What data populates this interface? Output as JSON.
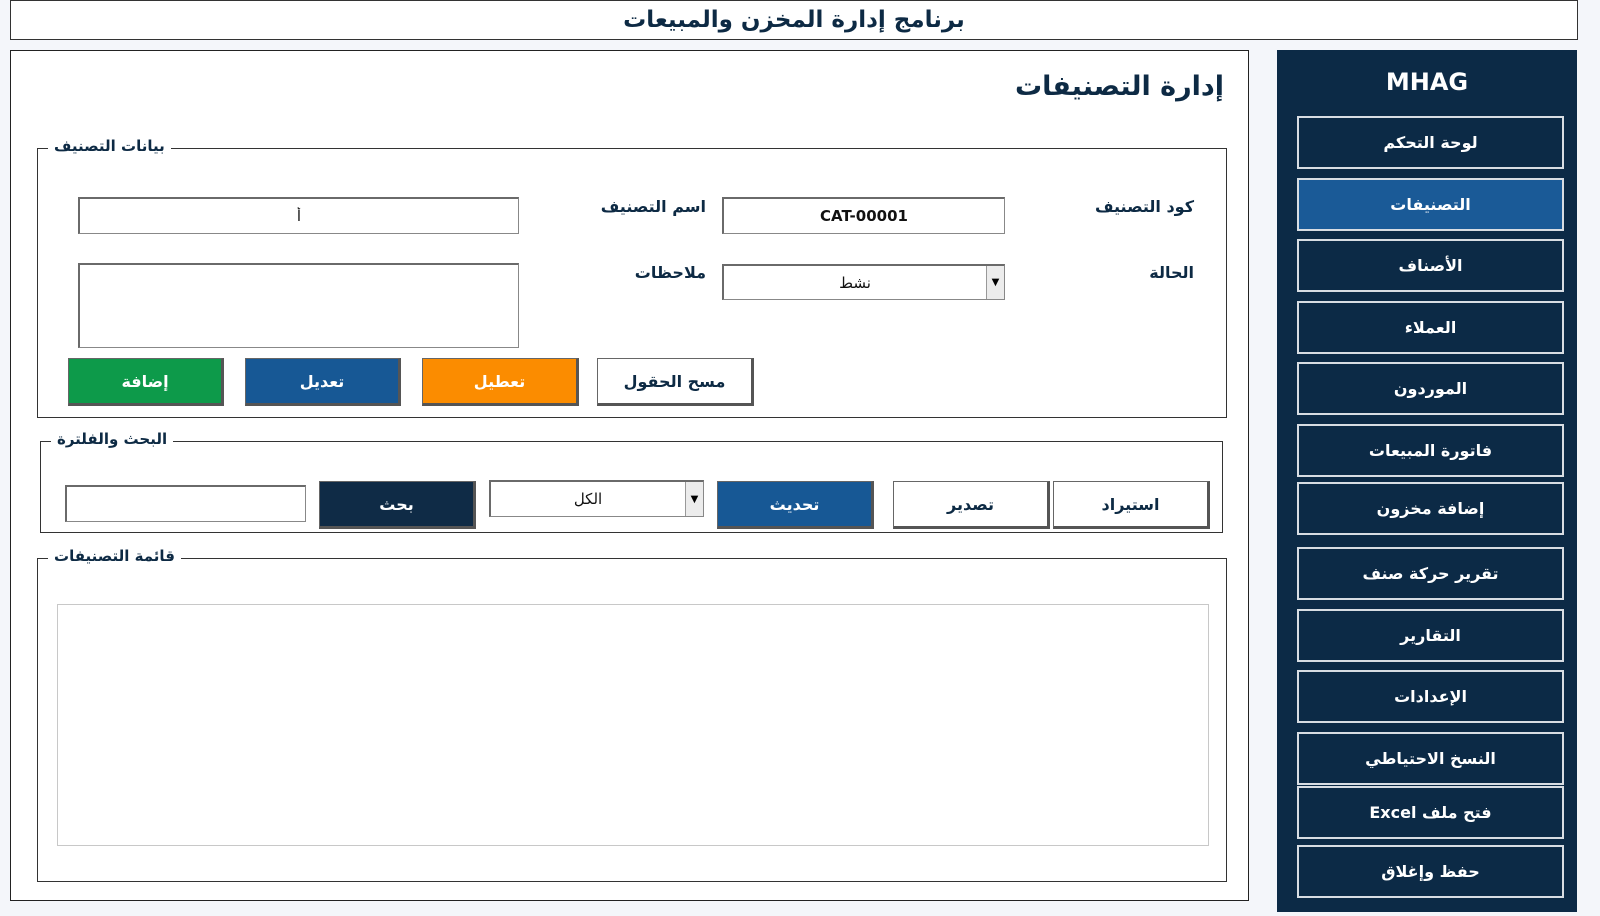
{
  "app_title": "برنامج إدارة المخزن والمبيعات",
  "page": {
    "heading": "إدارة التصنيفات",
    "category_section": {
      "legend": "بيانات التصنيف",
      "code_label": "كود التصنيف",
      "code_value": "CAT-00001",
      "name_label": "اسم التصنيف",
      "name_value": "أ",
      "status_label": "الحالة",
      "status_value": "نشط",
      "notes_label": "ملاحظات",
      "notes_value": "",
      "buttons": {
        "add": "إضافة",
        "edit": "تعديل",
        "disable": "تعطيل",
        "clear": "مسح الحقول"
      },
      "colors": {
        "add": "#0d9a4a",
        "edit": "#175895",
        "disable": "#fb8c00"
      }
    },
    "search_section": {
      "legend": "البحث والفلترة",
      "search_value": "",
      "search_button": "بحث",
      "filter_value": "الكل",
      "refresh_button": "تحديث",
      "export_button": "تصدير",
      "import_button": "استيراد"
    },
    "list_section": {
      "legend": "قائمة التصنيفات"
    }
  },
  "sidebar": {
    "brand": "MHAG",
    "accent": "#1a5a97",
    "background": "#0c2a46",
    "items": [
      {
        "label": "لوحة التحكم",
        "active": false
      },
      {
        "label": "التصنيفات",
        "active": true
      },
      {
        "label": "الأصناف",
        "active": false
      },
      {
        "label": "العملاء",
        "active": false
      },
      {
        "label": "الموردون",
        "active": false
      },
      {
        "label": "فاتورة المبيعات",
        "active": false
      },
      {
        "label": "إضافة مخزون",
        "active": false
      },
      {
        "label": "تقرير حركة صنف",
        "active": false
      },
      {
        "label": "التقارير",
        "active": false
      },
      {
        "label": "الإعدادات",
        "active": false
      },
      {
        "label": "النسخ الاحتياطي",
        "active": false
      },
      {
        "label": "فتح ملف Excel",
        "active": false
      },
      {
        "label": "حفظ وإغلاق",
        "active": false
      }
    ]
  }
}
